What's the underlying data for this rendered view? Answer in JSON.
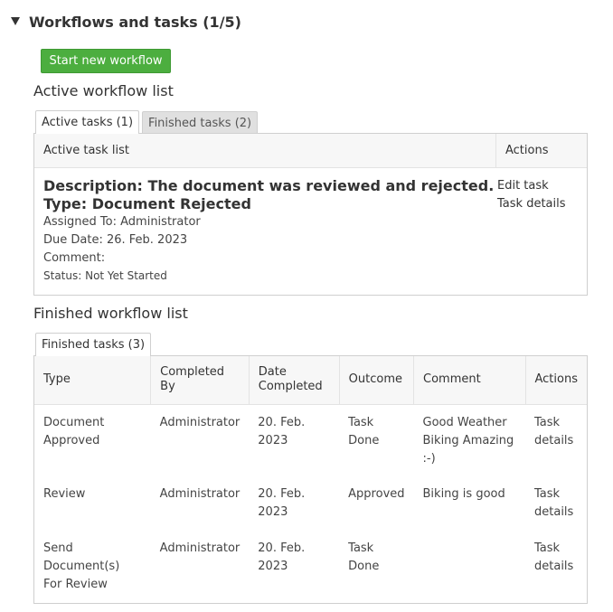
{
  "panel": {
    "title": "Workflows and tasks (1/5)"
  },
  "start_button_label": "Start new workflow",
  "active": {
    "section_title": "Active workflow list",
    "tabs": [
      {
        "label": "Active tasks (1)",
        "selected": true
      },
      {
        "label": "Finished tasks (2)",
        "selected": false
      }
    ],
    "header": {
      "list": "Active task list",
      "actions": "Actions"
    },
    "task": {
      "description": "Description: The document was reviewed and rejected.",
      "type": "Type: Document Rejected",
      "assigned": "Assigned To: Administrator",
      "due": "Due Date: 26. Feb. 2023",
      "comment": "Comment:",
      "status": "Status: Not Yet Started",
      "actions": [
        "Edit task",
        "Task details"
      ]
    }
  },
  "finished": {
    "section_title": "Finished workflow list",
    "tab": "Finished tasks (3)",
    "columns": [
      "Type",
      "Completed By",
      "Date Completed",
      "Outcome",
      "Comment",
      "Actions"
    ],
    "rows": [
      {
        "type": "Document Approved",
        "by": "Administrator",
        "date": "20. Feb. 2023",
        "outcome": "Task Done",
        "comment": "Good Weather Biking Amazing :-)",
        "action": "Task details"
      },
      {
        "type": "Review",
        "by": "Administrator",
        "date": "20. Feb. 2023",
        "outcome": "Approved",
        "comment": "Biking is good",
        "action": "Task details"
      },
      {
        "type": "Send Document(s) For Review",
        "by": "Administrator",
        "date": "20. Feb. 2023",
        "outcome": "Task Done",
        "comment": "",
        "action": "Task details"
      }
    ]
  }
}
